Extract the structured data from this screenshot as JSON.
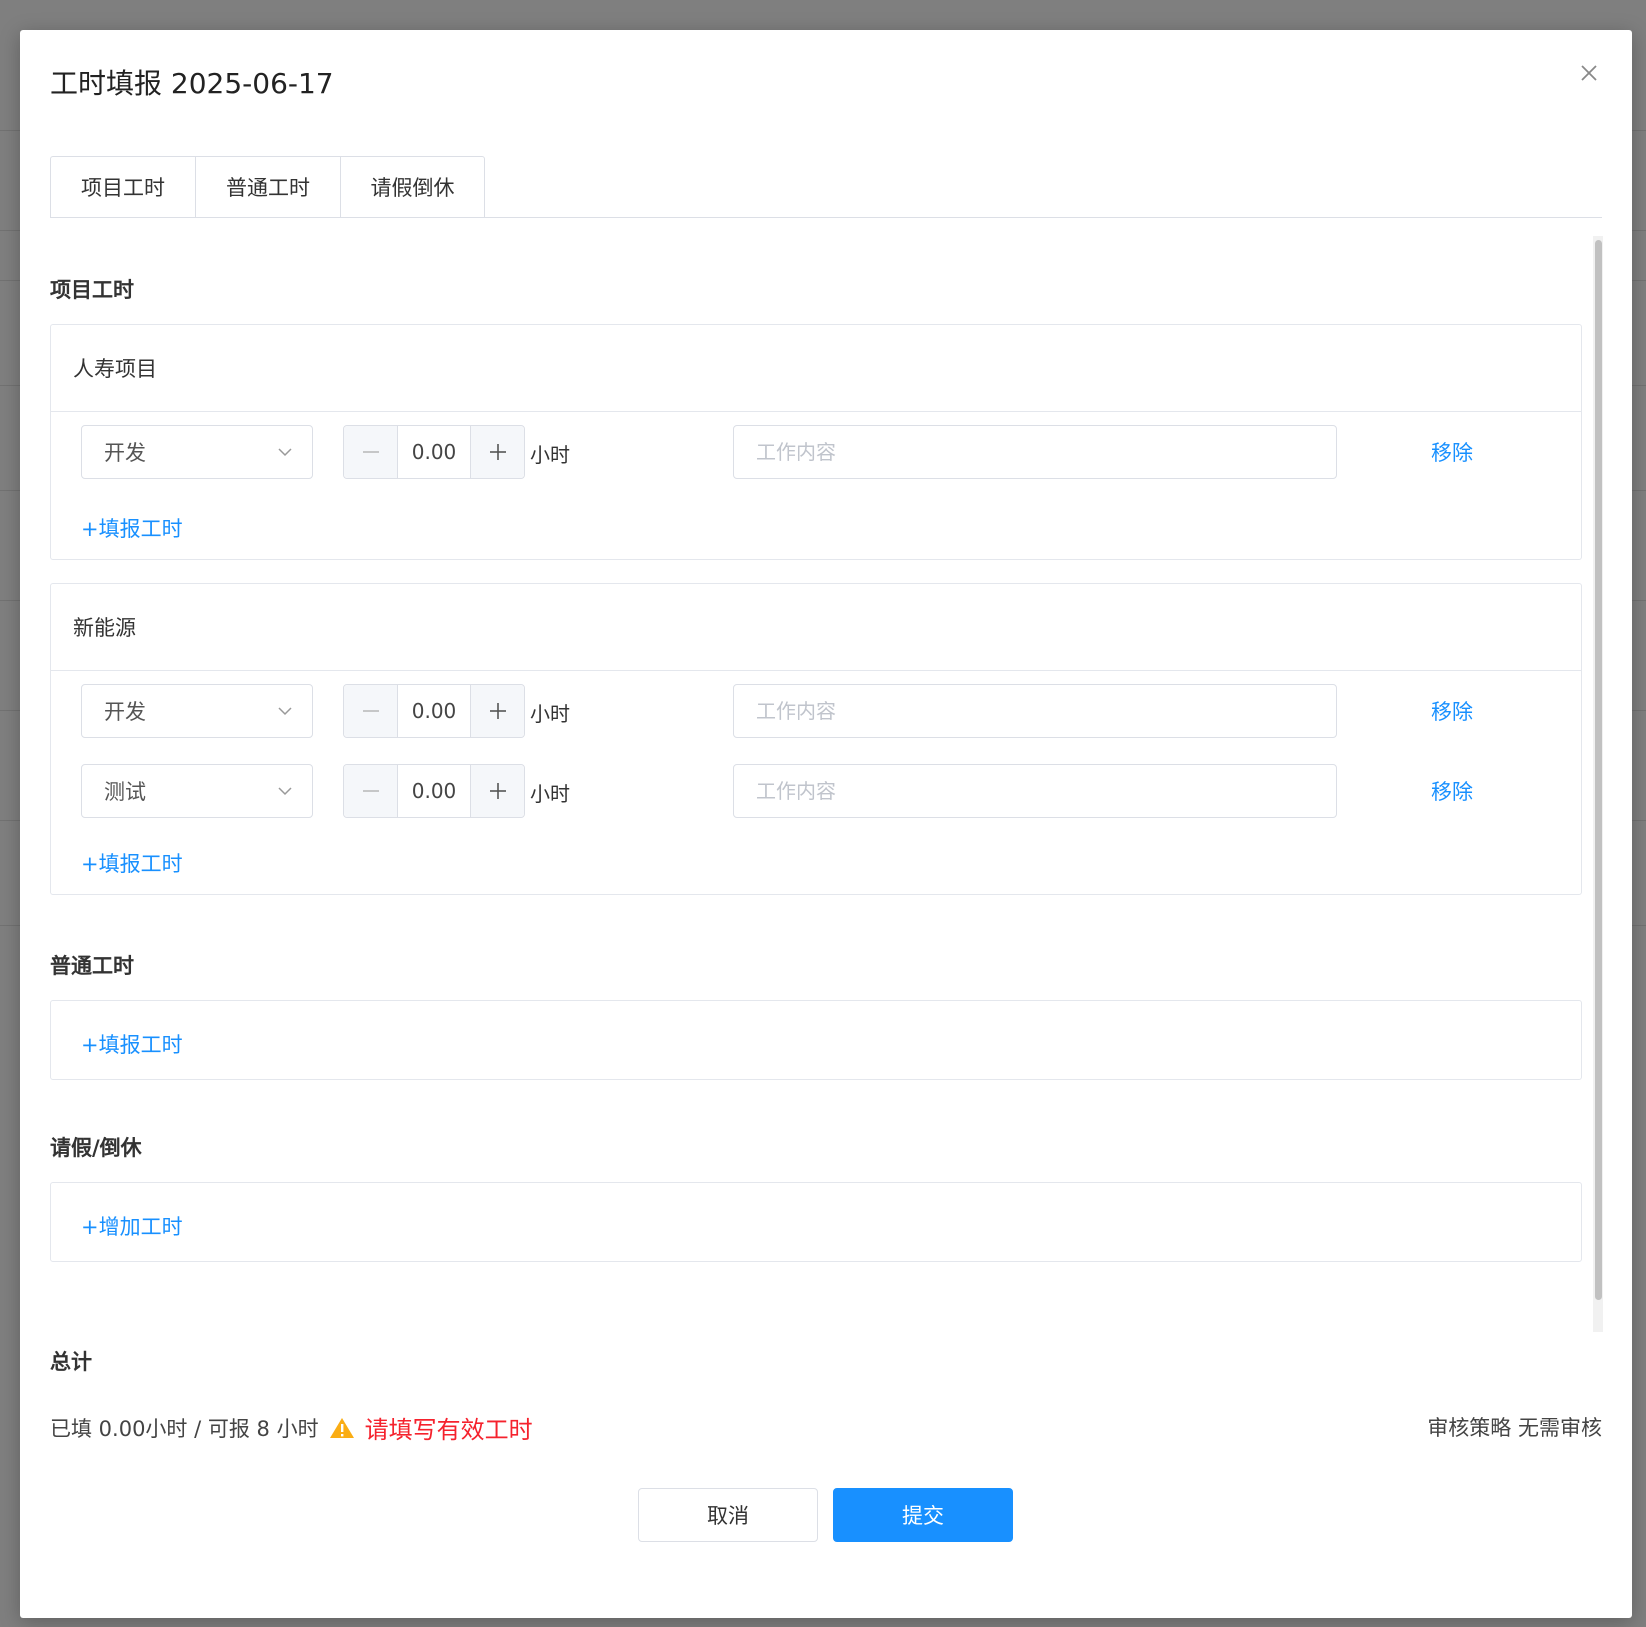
{
  "modal": {
    "title": "工时填报 2025-06-17"
  },
  "tabs": [
    {
      "label": "项目工时"
    },
    {
      "label": "普通工时"
    },
    {
      "label": "请假倒休"
    }
  ],
  "project_section": {
    "title": "项目工时",
    "projects": [
      {
        "name": "人寿项目",
        "rows": [
          {
            "type": "开发",
            "hours": "0.00",
            "unit": "小时",
            "content_placeholder": "工作内容",
            "remove_label": "移除"
          }
        ],
        "add_label": "+填报工时"
      },
      {
        "name": "新能源",
        "rows": [
          {
            "type": "开发",
            "hours": "0.00",
            "unit": "小时",
            "content_placeholder": "工作内容",
            "remove_label": "移除"
          },
          {
            "type": "测试",
            "hours": "0.00",
            "unit": "小时",
            "content_placeholder": "工作内容",
            "remove_label": "移除"
          }
        ],
        "add_label": "+填报工时"
      }
    ]
  },
  "normal_section": {
    "title": "普通工时",
    "add_label": "+填报工时"
  },
  "leave_section": {
    "title": "请假/倒休",
    "add_label": "+增加工时"
  },
  "total": {
    "title": "总计",
    "filled_text": "已填 0.00小时 / 可报 8 小时",
    "warning": "请填写有效工时",
    "policy": "审核策略 无需审核"
  },
  "footer": {
    "cancel_label": "取消",
    "submit_label": "提交"
  },
  "colors": {
    "primary": "#1890ff",
    "danger": "#f5222d",
    "warning_icon": "#faad14"
  },
  "icons": {
    "close": "close-icon",
    "chevron": "chevron-down-icon",
    "minus": "minus-icon",
    "plus": "plus-icon",
    "warning": "warning-icon"
  }
}
